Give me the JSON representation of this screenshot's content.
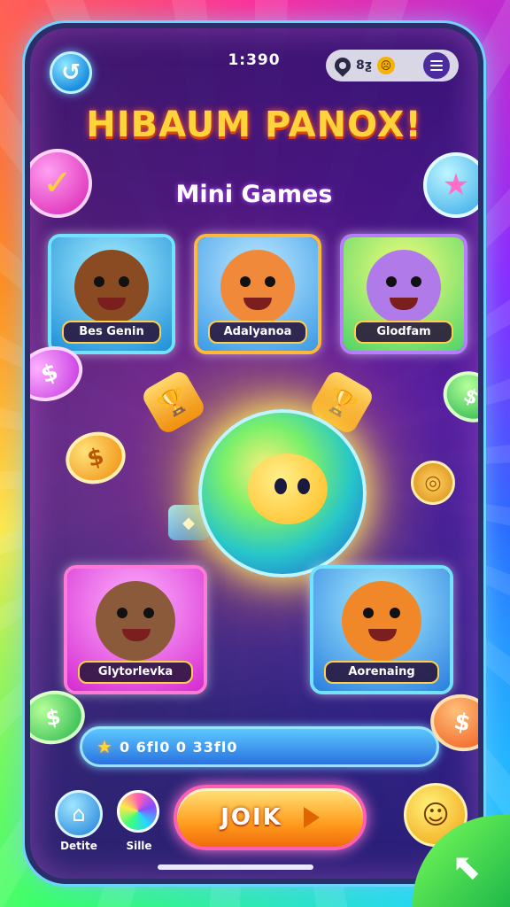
{
  "status_bar": {
    "time": "1:390",
    "pill_text": "8ƺ"
  },
  "header": {
    "title": "HIBAUM PANOX!",
    "subtitle": "Mini Games"
  },
  "game_cards": [
    {
      "label": "Bes Genin"
    },
    {
      "label": "Adalyanoa"
    },
    {
      "label": "Glodfam"
    },
    {
      "label": "Glytorlevka"
    },
    {
      "label": "Aorenaing"
    }
  ],
  "progress": {
    "text": "0 6fl0 0 33fl0"
  },
  "bottom_nav": {
    "left_label": "Detite",
    "middle_label": "Sille",
    "join_label": "JOIK"
  },
  "colors": {
    "accent_gold": "#ffd43a",
    "accent_blue": "#5bc8ff",
    "accent_pink": "#ff5fb3",
    "panel_purple": "#46148c"
  }
}
